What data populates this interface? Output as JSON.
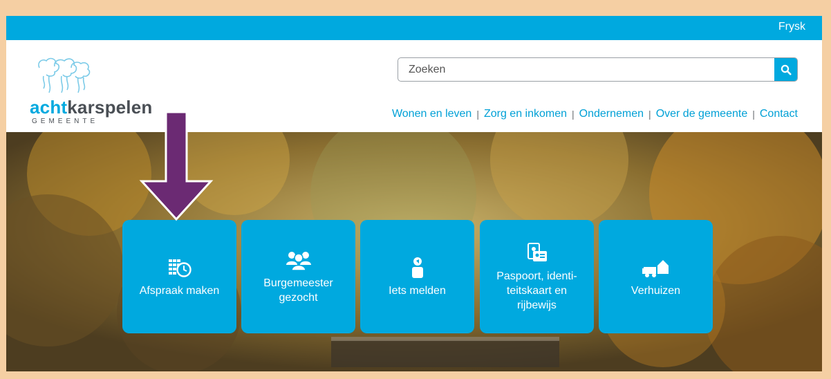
{
  "topbar": {
    "language_link": "Frysk"
  },
  "logo": {
    "word_part1": "acht",
    "word_part2": "karspelen",
    "sub": "GEMEENTE"
  },
  "search": {
    "placeholder": "Zoeken"
  },
  "nav": {
    "items": [
      "Wonen en leven",
      "Zorg en inkomen",
      "Ondernemen",
      "Over de gemeente",
      "Contact"
    ],
    "separator": "|"
  },
  "tiles": [
    {
      "label": "Afspraak maken",
      "icon": "calendar-clock-icon"
    },
    {
      "label": "Burgemeester\ngezocht",
      "icon": "people-group-icon"
    },
    {
      "label": "Iets melden",
      "icon": "person-speaking-icon"
    },
    {
      "label": "Paspoort, identi-\nteitskaart en\nrijbewijs",
      "icon": "id-card-icon"
    },
    {
      "label": "Verhuizen",
      "icon": "moving-truck-icon"
    }
  ],
  "colors": {
    "brand": "#00a9df",
    "frame": "#f5cfa3",
    "arrow": "#6b2a73",
    "text_dark": "#4a4f55"
  }
}
